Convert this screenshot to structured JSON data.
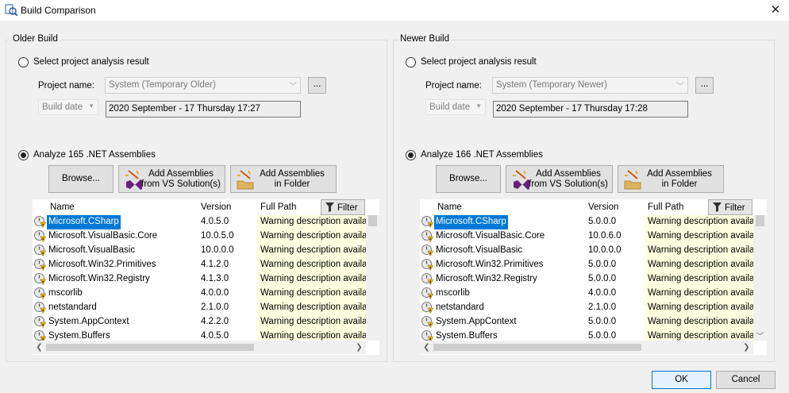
{
  "window": {
    "title": "Build Comparison",
    "close_glyph": "✕"
  },
  "older": {
    "group_title": "Older Build",
    "select_label": "Select project analysis result",
    "project_label": "Project name:",
    "project_value": "System (Temporary Older)",
    "ellipsis": "...",
    "build_date_label": "Build date",
    "build_date_value": "2020 September - 17 Thursday 17:27",
    "analyze_label": "Analyze 165 .NET Assemblies",
    "browse": "Browse...",
    "add_vs": [
      "Add Assemblies",
      "from VS Solution(s)"
    ],
    "add_folder": [
      "Add Assemblies",
      "in Folder"
    ],
    "columns": {
      "name": "Name",
      "version": "Version",
      "path": "Full Path"
    },
    "filter": "Filter",
    "rows": [
      {
        "name": "Microsoft.CSharp",
        "version": "4.0.5.0",
        "path": "Warning description available"
      },
      {
        "name": "Microsoft.VisualBasic.Core",
        "version": "10.0.5.0",
        "path": "Warning description available"
      },
      {
        "name": "Microsoft.VisualBasic",
        "version": "10.0.0.0",
        "path": "Warning description available"
      },
      {
        "name": "Microsoft.Win32.Primitives",
        "version": "4.1.2.0",
        "path": "Warning description available"
      },
      {
        "name": "Microsoft.Win32.Registry",
        "version": "4.1.3.0",
        "path": "Warning description available"
      },
      {
        "name": "mscorlib",
        "version": "4.0.0.0",
        "path": "Warning description available"
      },
      {
        "name": "netstandard",
        "version": "2.1.0.0",
        "path": "Warning description available"
      },
      {
        "name": "System.AppContext",
        "version": "4.2.2.0",
        "path": "Warning description available"
      },
      {
        "name": "System.Buffers",
        "version": "4.0.5.0",
        "path": "Warning description available"
      }
    ]
  },
  "newer": {
    "group_title": "Newer Build",
    "select_label": "Select project analysis result",
    "project_label": "Project name:",
    "project_value": "System (Temporary Newer)",
    "ellipsis": "...",
    "build_date_label": "Build date",
    "build_date_value": "2020 September - 17 Thursday 17:28",
    "analyze_label": "Analyze 166 .NET Assemblies",
    "browse": "Browse...",
    "add_vs": [
      "Add Assemblies",
      "from VS Solution(s)"
    ],
    "add_folder": [
      "Add Assemblies",
      "in Folder"
    ],
    "columns": {
      "name": "Name",
      "version": "Version",
      "path": "Full Path"
    },
    "filter": "Filter",
    "rows": [
      {
        "name": "Microsoft.CSharp",
        "version": "5.0.0.0",
        "path": "Warning description available"
      },
      {
        "name": "Microsoft.VisualBasic.Core",
        "version": "10.0.6.0",
        "path": "Warning description available"
      },
      {
        "name": "Microsoft.VisualBasic",
        "version": "10.0.0.0",
        "path": "Warning description available"
      },
      {
        "name": "Microsoft.Win32.Primitives",
        "version": "5.0.0.0",
        "path": "Warning description available"
      },
      {
        "name": "Microsoft.Win32.Registry",
        "version": "5.0.0.0",
        "path": "Warning description available"
      },
      {
        "name": "mscorlib",
        "version": "4.0.0.0",
        "path": "Warning description available"
      },
      {
        "name": "netstandard",
        "version": "2.1.0.0",
        "path": "Warning description available"
      },
      {
        "name": "System.AppContext",
        "version": "5.0.0.0",
        "path": "Warning description available"
      },
      {
        "name": "System.Buffers",
        "version": "5.0.0.0",
        "path": "Warning description available"
      }
    ]
  },
  "footer": {
    "ok": "OK",
    "cancel": "Cancel"
  },
  "colors": {
    "selection": "#0078d7",
    "warning_bg": "#ffffe0"
  }
}
